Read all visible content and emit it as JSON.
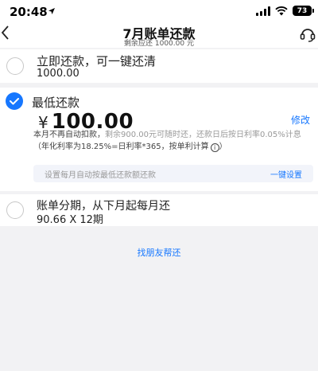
{
  "status_bar": {
    "time": "20:48",
    "battery": "73"
  },
  "header": {
    "title": "7月账单还款",
    "subtitle": "剩余应还 1000.00 元",
    "back_icon": "chevron-left-icon",
    "service_icon": "customer-service-icon"
  },
  "options": {
    "pay_now": {
      "title": "立即还款，可一键还清",
      "amount": "1000.00",
      "selected": false
    },
    "minimum": {
      "title": "最低还款",
      "currency": "¥",
      "amount": "100.00",
      "modify_label": "修改",
      "desc_part1": "本月不再自动扣款，",
      "desc_part2": "剩余900.00元可随时还，还款日后按日利率0.05%计息",
      "desc_part3": "（年化利率为18.25%=日利率*365，按单利计算",
      "selected": true,
      "auto_setting_text": "设置每月自动按最低还款额还款",
      "auto_setting_btn": "一键设置"
    },
    "installment": {
      "title": "账单分期，从下月起每月还",
      "amount": "90.66 X 12期",
      "selected": false
    }
  },
  "friend_link": "找朋友帮还",
  "colors": {
    "accent": "#1677ff",
    "background": "#f2f2f4",
    "card": "#ffffff"
  }
}
